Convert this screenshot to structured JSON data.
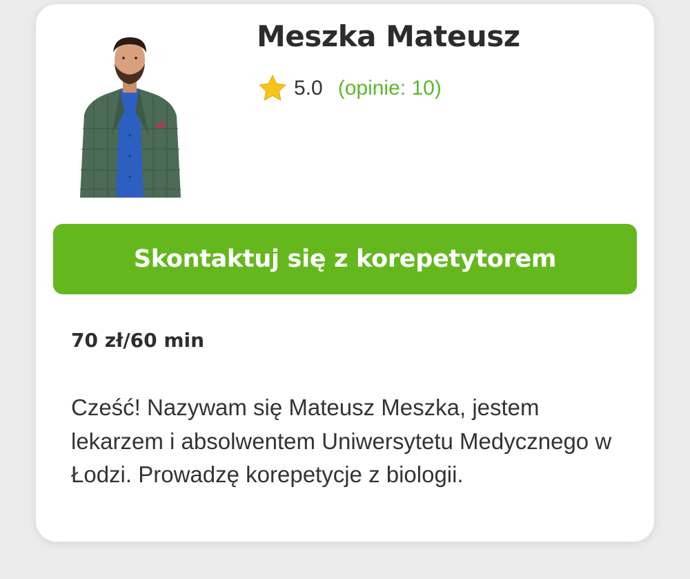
{
  "tutor": {
    "name": "Meszka Mateusz",
    "rating": "5.0",
    "reviews_label": "(opinie: 10)",
    "price": "70 zł/60 min",
    "description": "Cześć! Nazywam się Mateusz Meszka, jestem lekarzem i absolwentem Uniwersytetu Medycznego w Łodzi. Prowadzę korepetycje z biologii."
  },
  "actions": {
    "contact_label": "Skontaktuj się z korepetytorem"
  },
  "icons": {
    "rating": "star-icon"
  },
  "colors": {
    "accent_green": "#64b81e",
    "link_green": "#5cb82a",
    "star_yellow": "#f5c518",
    "text_dark": "#2c2c2c",
    "card_background": "#ffffff",
    "page_background": "#ececec"
  }
}
